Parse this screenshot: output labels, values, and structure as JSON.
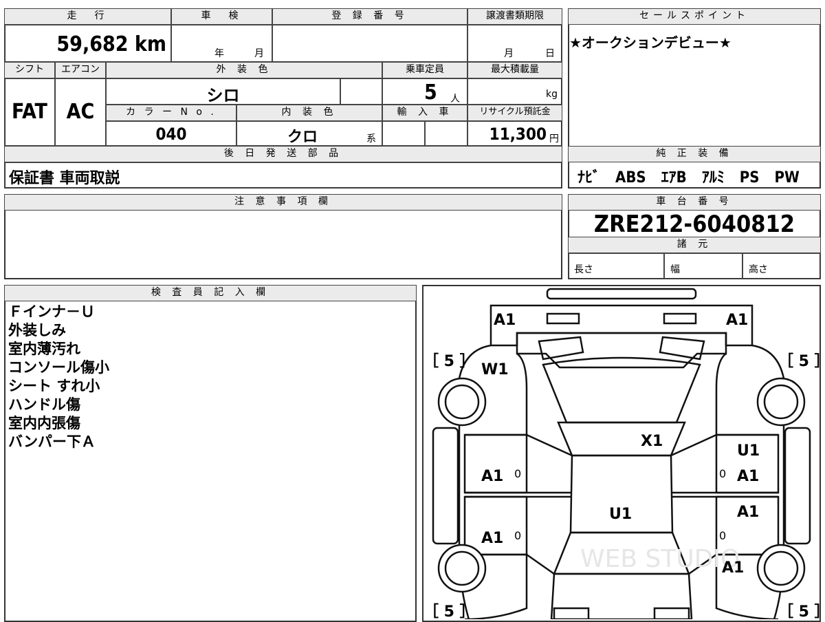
{
  "top_table": {
    "mileage_label": "走　行",
    "mileage_value": "59,682 km",
    "shaken_label": "車　検",
    "shaken_year": "年",
    "shaken_month": "月",
    "registration_label": "登 録 番 号",
    "transfer_label": "譲渡書類期限",
    "transfer_month": "月",
    "transfer_day": "日",
    "shift_label": "シフト",
    "shift_value": "FAT",
    "ac_label": "エアコン",
    "ac_value": "AC",
    "exterior_color_label": "外 装 色",
    "exterior_color_value": "シロ",
    "capacity_label": "乗車定員",
    "capacity_value": "5",
    "capacity_unit": "人",
    "max_load_label": "最大積載量",
    "max_load_unit": "kg",
    "color_no_label": "カ ラ ー N o .",
    "color_no_value": "040",
    "interior_color_label": "内 装 色",
    "interior_color_value": "クロ",
    "interior_color_suffix": "系",
    "import_label": "輸 入 車",
    "recycle_label": "リサイクル預託金",
    "recycle_value": "11,300",
    "recycle_unit": "円",
    "later_parts_label": "後 日 発 送 部 品",
    "later_parts_value": "保証書 車両取説"
  },
  "sales_point": {
    "label": "セールスポイント",
    "value": "★オークションデビュー★"
  },
  "genuine_equipment": {
    "label": "純 正 装 備",
    "value": "ﾅﾋﾞ　ABS　ｴｱB　ｱﾙﾐ　PS　PW"
  },
  "caution": {
    "label": "注 意 事 項 欄",
    "value": ""
  },
  "chassis": {
    "label": "車 台 番 号",
    "value": "ZRE212-6040812",
    "spec_label": "諸 元",
    "length_label": "長さ",
    "width_label": "幅",
    "height_label": "高さ"
  },
  "inspector": {
    "label": "検 査 員 記 入 欄",
    "notes": [
      "Ｆインナ－Ｕ",
      "外装しみ",
      "室内薄汚れ",
      "コンソール傷小",
      "シート すれ小",
      "ハンドル傷",
      "室内内張傷",
      "バンパー下Ａ"
    ]
  },
  "car_diagram": {
    "tire_fl": "［ 5 ］",
    "tire_fr": "［ 5 ］",
    "tire_rl": "［ 5 ］",
    "tire_rr": "［ 5 ］",
    "front_left": "A1",
    "front_right": "A1",
    "windshield": "W1",
    "roof": "X1",
    "right_upper": "U1",
    "left_front_door": "A1",
    "right_front_door": "A1",
    "cabin": "U1",
    "left_rear_door": "A1",
    "right_rear_door": "A1",
    "right_rear_quarter": "A1",
    "door_marks": "0"
  },
  "watermark": "WEB STUDIO"
}
